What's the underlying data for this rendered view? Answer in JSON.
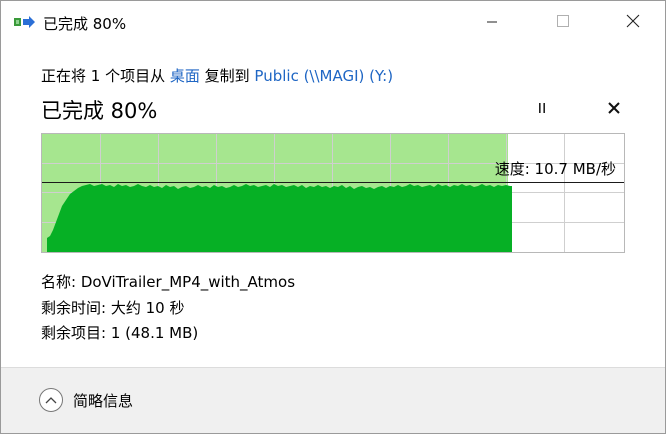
{
  "window": {
    "title": "已完成 80%"
  },
  "transfer": {
    "prefix": "正在将 1 个项目从 ",
    "source": "桌面",
    "middle": " 复制到 ",
    "destination": "Public (\\\\MAGI) (Y:)",
    "progress_heading": "已完成 80%",
    "progress_fraction": 0.8,
    "speed_text": "速度: 10.7 MB/秒"
  },
  "details": {
    "name_label": "名称: ",
    "name_value": "DoViTrailer_MP4_with_Atmos",
    "time_label": "剩余时间: ",
    "time_value": "大约 10 秒",
    "items_label": "剩余项目: ",
    "items_value": "1 (48.1 MB)"
  },
  "footer": {
    "less_details_label": "简略信息"
  },
  "colors": {
    "graph_fill": "#06b025",
    "graph_progress_bg": "#a6e68f",
    "graph_grid": "#cfcfcf",
    "link": "#1f66c4"
  },
  "icons": {
    "title": "copy-transfer-icon",
    "minimize": "minimize-icon",
    "maximize": "maximize-icon",
    "close": "close-icon",
    "pause": "pause-icon",
    "cancel": "cancel-icon",
    "collapse": "chevron-up-icon"
  }
}
